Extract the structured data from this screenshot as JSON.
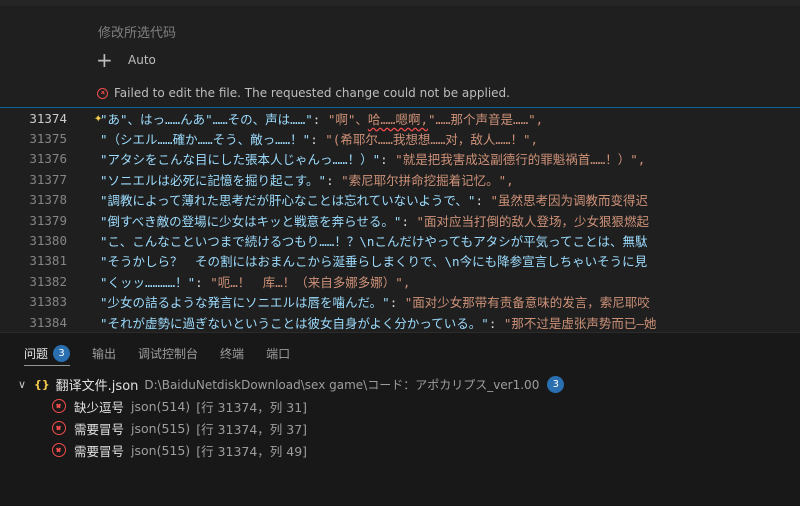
{
  "chat": {
    "top_text": "...",
    "prompt_label": "修改所选代码",
    "add_icon": "plus-icon",
    "mode_label": "Auto",
    "error_message": "Failed to edit the file. The requested change could not be applied."
  },
  "editor": {
    "lines": [
      {
        "num": "31374",
        "key": "\"あ\"、はっ……んあ\"……その、声は……\"",
        "sep": ": ",
        "val_a": "\"啊\"、",
        "val_err": "哈……嗯啊,",
        "val_b": "\"……那个声音是……\","
      },
      {
        "num": "31375",
        "key": "\"（シエル……確か……そう、敵っ……！\"",
        "sep": ": ",
        "val": "\"(希耶尔……我想想……对，敌人……！\","
      },
      {
        "num": "31376",
        "key": "\"アタシをこんな目にした張本人じゃんっ……！）\"",
        "sep": ": ",
        "val": "\"就是把我害成这副德行的罪魁祸首……！）\","
      },
      {
        "num": "31377",
        "key": "\"ソニエルは必死に記憶を掘り起こす。\"",
        "sep": ": ",
        "val": "\"索尼耶尔拼命挖掘着记忆。\","
      },
      {
        "num": "31378",
        "key": "\"調教によって薄れた思考だが肝心なことは忘れていないようで、\"",
        "sep": ": ",
        "val": "\"虽然思考因为调教而变得迟"
      },
      {
        "num": "31379",
        "key": "\"倒すべき敵の登場に少女はキッと戦意を奔らせる。\"",
        "sep": ": ",
        "val": "\"面对应当打倒的敌人登场，少女狠狠燃起"
      },
      {
        "num": "31380",
        "key": "\"こ、こんなこといつまで続けるつもり……！？\\nこんだけやってもアタシが平気ってことは、無駄",
        "sep": "",
        "val": ""
      },
      {
        "num": "31381",
        "key": "\"そうかしら？　その割にはおまんこから涎垂らしまくりで、\\n今にも降参宣言しちゃいそうに見",
        "sep": "",
        "val": ""
      },
      {
        "num": "31382",
        "key": "\"くッッ…………！\"",
        "sep": ": ",
        "val": "\"呃…！　库…！（来自多娜多娜）\","
      },
      {
        "num": "31383",
        "key": "\"少女の詰るような発言にソニエルは唇を噛んだ。\"",
        "sep": ": ",
        "val": "\"面对少女那带有责备意味的发言，索尼耶咬"
      },
      {
        "num": "31384",
        "key": "\"それが虚勢に過ぎないということは彼女自身がよく分かっている。\"",
        "sep": ": ",
        "val": "\"那不过是虚张声势而已—她"
      }
    ]
  },
  "panel": {
    "tabs": [
      {
        "label": "问题",
        "badge": "3"
      },
      {
        "label": "输出"
      },
      {
        "label": "调试控制台"
      },
      {
        "label": "终端"
      },
      {
        "label": "端口"
      }
    ],
    "file": {
      "name": "翻译文件.json",
      "path": "D:\\BaiduNetdiskDownload\\sex game\\コード：アポカリプス_ver1.00",
      "count": "3"
    },
    "problems": [
      {
        "message": "缺少逗号",
        "source": "json(514)",
        "location": "[行 31374，列 31]"
      },
      {
        "message": "需要冒号",
        "source": "json(515)",
        "location": "[行 31374，列 37]"
      },
      {
        "message": "需要冒号",
        "source": "json(515)",
        "location": "[行 31374，列 49]"
      }
    ]
  },
  "colors": {
    "background": "#1f1f1f",
    "error": "#f14c4c",
    "badge": "#2a6fb0",
    "key": "#9cdcfe",
    "string": "#ce9178"
  }
}
